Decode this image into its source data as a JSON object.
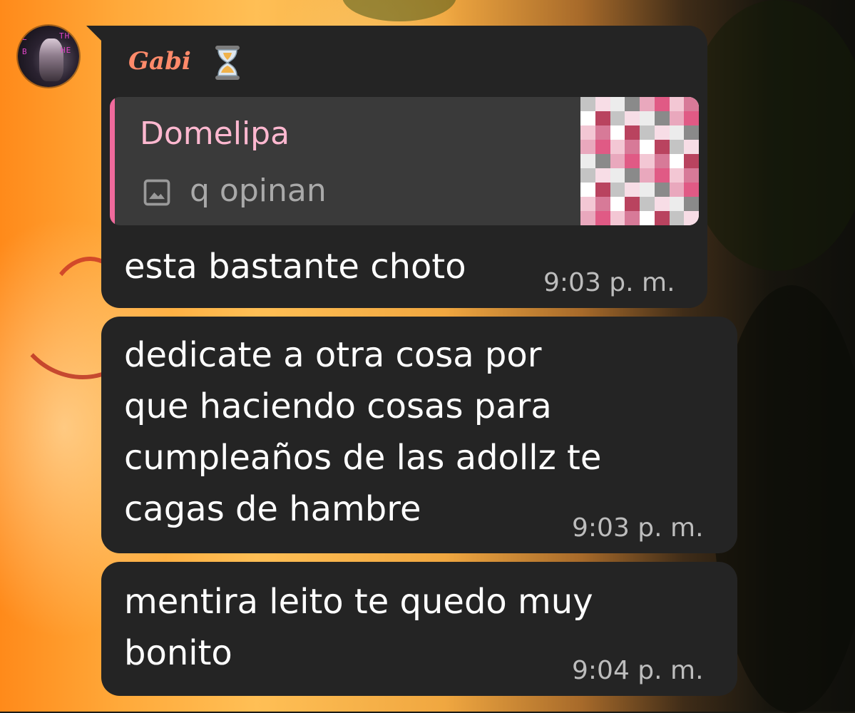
{
  "chat": {
    "sender_name": "Gabi",
    "sender_status_icon": "hourglass-icon",
    "avatar_overlay_text": [
      "L",
      "TH",
      "B",
      "HE"
    ],
    "reply": {
      "quoted_author": "Domelipa",
      "quoted_text": "q opinan",
      "quoted_media_icon": "image-icon",
      "thumbnail": "blurred-pink-image-thumbnail"
    },
    "messages": [
      {
        "text": "esta bastante choto",
        "time": "9:03 p. m."
      },
      {
        "text": "dedicate a otra cosa por\nque haciendo cosas para\ncumpleaños de las adollz te\ncagas de hambre",
        "time": "9:03 p. m."
      },
      {
        "text": "mentira leito te quedo muy\nbonito",
        "time": "9:04 p. m."
      }
    ]
  },
  "colors": {
    "bubble": "#242424",
    "sender_name": "#ff8a6a",
    "quote_accent": "#f06a9c",
    "quote_name": "#ffb8d0",
    "timestamp": "#bdbdbd"
  }
}
